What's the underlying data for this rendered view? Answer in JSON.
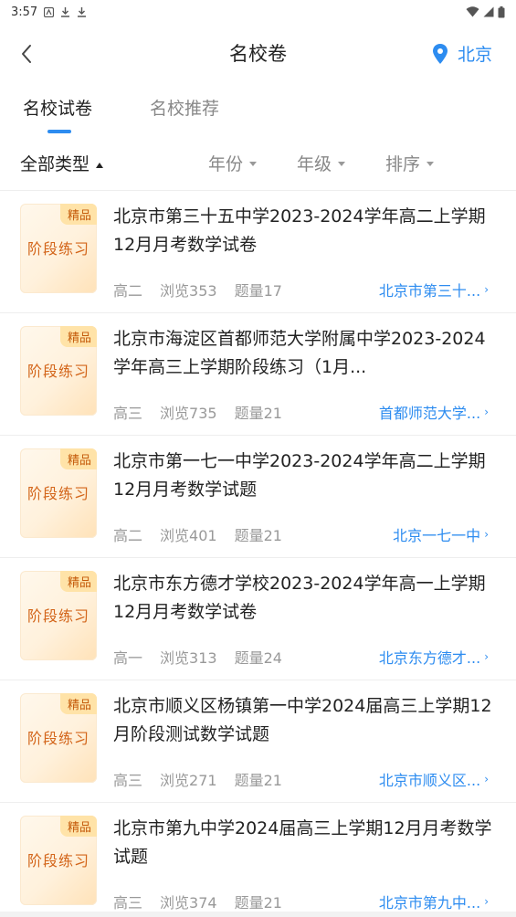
{
  "status_bar": {
    "time": "3:57"
  },
  "header": {
    "title": "名校卷",
    "location": "北京"
  },
  "tabs": [
    {
      "label": "名校试卷",
      "active": true
    },
    {
      "label": "名校推荐",
      "active": false
    }
  ],
  "filters": {
    "type": "全部类型",
    "year": "年份",
    "grade": "年级",
    "sort": "排序"
  },
  "thumb": {
    "badge": "精品",
    "label": "阶段练习"
  },
  "items": [
    {
      "title": "北京市第三十五中学2023-2024学年高二上学期12月月考数学试卷",
      "grade": "高二",
      "views": "浏览353",
      "count": "题量17",
      "school": "北京市第三十..."
    },
    {
      "title": "北京市海淀区首都师范大学附属中学2023-2024学年高三上学期阶段练习（1月...",
      "grade": "高三",
      "views": "浏览735",
      "count": "题量21",
      "school": "首都师范大学..."
    },
    {
      "title": "北京市第一七一中学2023-2024学年高二上学期12月月考数学试题",
      "grade": "高二",
      "views": "浏览401",
      "count": "题量21",
      "school": "北京一七一中"
    },
    {
      "title": "北京市东方德才学校2023-2024学年高一上学期12月月考数学试卷",
      "grade": "高一",
      "views": "浏览313",
      "count": "题量24",
      "school": "北京东方德才..."
    },
    {
      "title": "北京市顺义区杨镇第一中学2024届高三上学期12月阶段测试数学试题",
      "grade": "高三",
      "views": "浏览271",
      "count": "题量21",
      "school": "北京市顺义区..."
    },
    {
      "title": "北京市第九中学2024届高三上学期12月月考数学试题",
      "grade": "高三",
      "views": "浏览374",
      "count": "题量21",
      "school": "北京市第九中..."
    }
  ],
  "colors": {
    "accent": "#2d8cf0",
    "badge_text": "#c45a0a",
    "thumb_text": "#d3651a"
  }
}
